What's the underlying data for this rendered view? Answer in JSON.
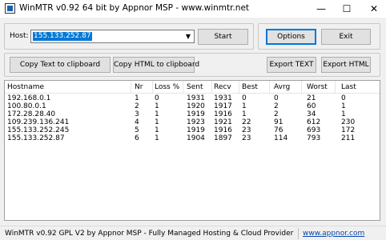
{
  "window": {
    "title": "WinMTR v0.92 64 bit by Appnor MSP - www.winmtr.net",
    "minimize_glyph": "—",
    "maximize_glyph": "☐",
    "close_glyph": "✕"
  },
  "host": {
    "label": "Host:",
    "value": "155.133.252.87",
    "dropdown_glyph": "▼"
  },
  "buttons": {
    "start": "Start",
    "options": "Options",
    "exit": "Exit",
    "copy_text": "Copy Text to clipboard",
    "copy_html": "Copy HTML to clipboard",
    "export_text": "Export TEXT",
    "export_html": "Export HTML"
  },
  "table": {
    "columns": [
      "Hostname",
      "Nr",
      "Loss %",
      "Sent",
      "Recv",
      "Best",
      "Avrg",
      "Worst",
      "Last"
    ],
    "rows": [
      [
        "192.168.0.1",
        "1",
        "0",
        "1931",
        "1931",
        "0",
        "0",
        "21",
        "0"
      ],
      [
        "100.80.0.1",
        "2",
        "1",
        "1920",
        "1917",
        "1",
        "2",
        "60",
        "1"
      ],
      [
        "172.28.28.40",
        "3",
        "1",
        "1919",
        "1916",
        "1",
        "2",
        "34",
        "1"
      ],
      [
        "109.239.136.241",
        "4",
        "1",
        "1923",
        "1921",
        "22",
        "91",
        "612",
        "230"
      ],
      [
        "155.133.252.245",
        "5",
        "1",
        "1919",
        "1916",
        "23",
        "76",
        "693",
        "172"
      ],
      [
        "155.133.252.87",
        "6",
        "1",
        "1904",
        "1897",
        "23",
        "114",
        "793",
        "211"
      ]
    ]
  },
  "status": {
    "text": "WinMTR v0.92 GPL V2 by Appnor MSP - Fully Managed Hosting & Cloud Provider",
    "link": "www.appnor.com"
  }
}
